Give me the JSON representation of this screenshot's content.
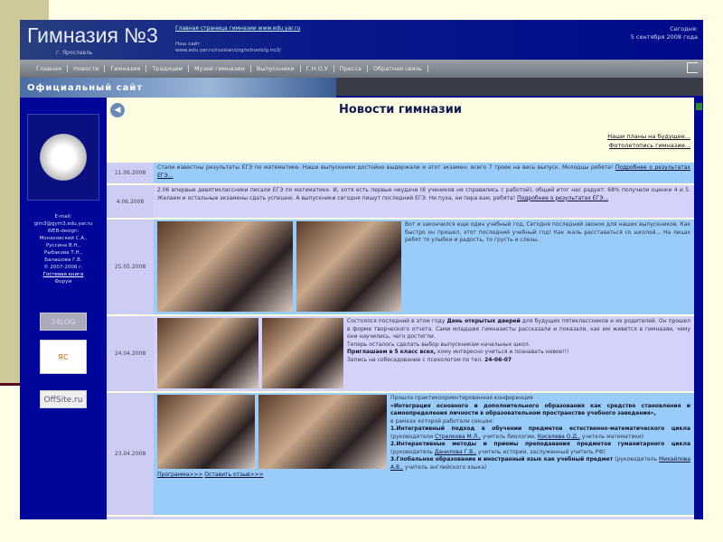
{
  "site": {
    "title": "Гимназия №3",
    "city": "г. Ярославль",
    "home_link": "Главная страница гимназии www.edu.yar.ru",
    "old_site_label": "Наш сайт",
    "old_site_url": "www.edu.yar.ru/russian/org/schools/g.no3/",
    "today_label": "Сегодня:",
    "today_date": "5 сентября 2008 года",
    "banner": "Официальный сайт"
  },
  "nav": [
    "Главная",
    "Новости",
    "Гимназия",
    "Традиции",
    "Музей гимназии",
    "Выпускники",
    "Г.Н.О.У",
    "Пресса",
    "Обратная связь"
  ],
  "sidebar": {
    "credits": [
      "E-mail:",
      "gim3@gym3.edu.yar.ru",
      "WEB-design:",
      "Монаховский С.А.,",
      "Руссина В.Н.,",
      "Рыбакова Т.Н.,",
      "Балашова Г.В.",
      "© 2007-2008 г.",
      "Гостевая книга",
      "Форум"
    ],
    "badges": [
      "24LOG",
      "ЯС",
      "OffSite.ru"
    ]
  },
  "main": {
    "title": "Новости гимназии",
    "links": [
      "Наши планы на будущее...",
      "Фотолетопись гимназии..."
    ],
    "news": [
      {
        "date": "11.06.2008",
        "text": "Стали известны результаты ЕГЭ по математике. Наши выпускники достойно выдержали и этот экзамен: всего 7 троек на весь выпуск. Молодцы ребята!",
        "link": "Подробнее о результатах ЕГЭ..."
      },
      {
        "date": "4.06.2008",
        "text": "2.06 впервые девятиклассники писали ЕГЭ по математике. И, хотя есть первые неудачи (6 учеников не справились с работой), общий итог нас радует: 68% получили оценки 4 и 5. Желаем и остальные экзамены сдать успешно. А выпускники сегодня пишут последний ЕГЭ. Ни пуха, ни пера вам, ребята!",
        "link": "Подробнее о результатах ЕГЭ..."
      },
      {
        "date": "25.05.2008",
        "text": "Вот и закончился еще один учебный год. Сегодня последний звонок для наших выпускников. Как быстро он прошел, этот последний учебный год! Как жаль расставаться со школой... На лицах ребят то улыбки и радость, то грусть и слезы."
      },
      {
        "date": "24.04.2008",
        "t1": "Состоялся последний в этом году",
        "b1": "День открытых дверей",
        "t2": "для будущих пятиклассников и их родителей. Он прошел в форме творческого отчета. Сами младшие гимназисты рассказали и показали, как им живется в гимназии, чему они научились, чего достигли.",
        "t3": "Теперь осталось сделать выбор выпускникам начальных школ.",
        "b2": "Приглашаем в 5 класс всех,",
        "t4": "кому интересно учиться и познавать новое!!!",
        "t5": "Запись на собеседование с психологом по тел.",
        "phone": "24-06-07"
      },
      {
        "date": "23.04.2008",
        "t1": "Прошла практикоориентированная конференция",
        "b1": "«Интеграция основного и дополнительного образования как средство становления и самоопределения личности в образовательном пространстве учебного заведения»,",
        "t2": "в рамках которой работали секции:",
        "b2": "1.Интегративный подход в обучении предметов естественно-математического цикла",
        "t3": "(руководители",
        "l1": "Стрелкова М.Л.,",
        "t4": "учитель биологии,",
        "l2": "Киселева О.Д.,",
        "t5": "учитель математики)",
        "b3": "2.Интерактивные методы и приемы преподавания предметов гуманитарного цикла",
        "t6": "(руководитель",
        "l3": "Данилова Г.В.,",
        "t7": "учитель истории, заслуженный учитель РФ)",
        "b4": "3.Глобальное образование и иностранный язык как учебный предмет",
        "t8": "(руководитель",
        "l4": "Михайлова А.В.,",
        "t9": "учитель английского языка)",
        "l5": "Программа>>>",
        "l6": "Оставить отзыв>>>"
      }
    ]
  }
}
